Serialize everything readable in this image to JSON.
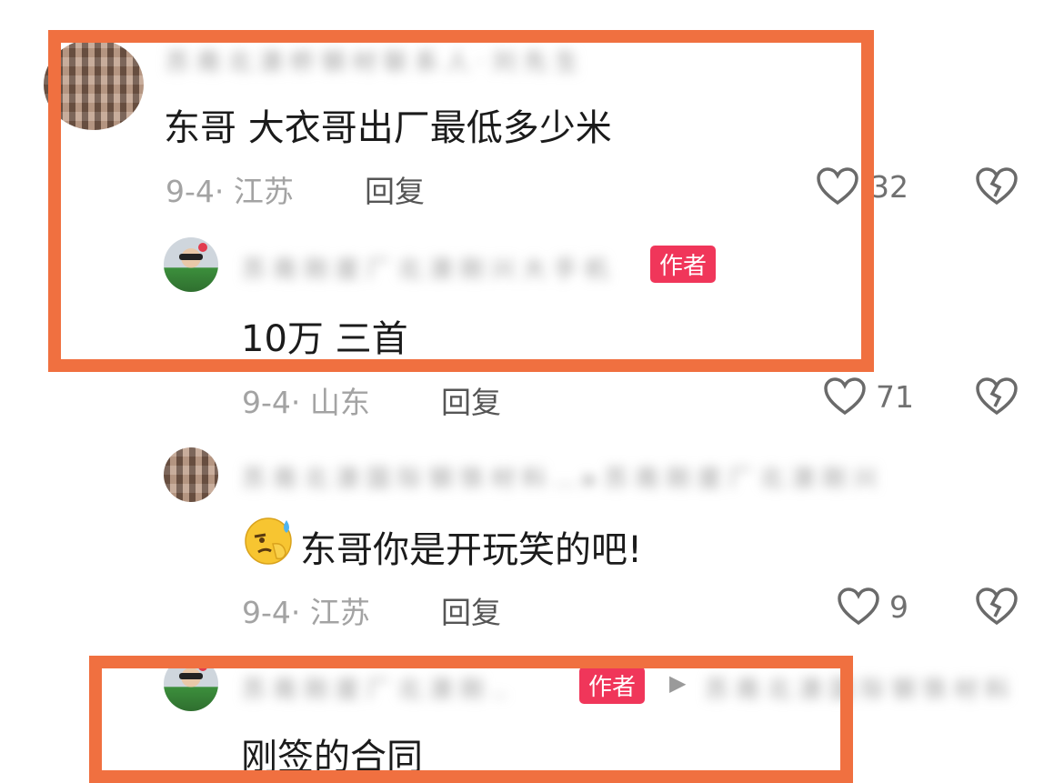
{
  "comments": [
    {
      "blurred_name": "苏 南 北 澳 桥 钢 材 联 系 人 · 刘 先 生",
      "text": "东哥  大衣哥出厂最低多少米",
      "date_loc": "9-4· 江苏",
      "reply_label": "回复",
      "likes": "32"
    },
    {
      "blurred_name": "苏 南 刚 度 厂  北 澳 刚 兴 大 手 机",
      "badge": "作者",
      "text": "10万 三首",
      "date_loc": "9-4· 山东",
      "reply_label": "回复",
      "likes": "71"
    },
    {
      "blurred_name": "苏 南 北 澳 国 际 钢 铁 材 料 …  ▸ 苏 南 刚 度 厂 北 澳 刚 兴",
      "text": "东哥你是开玩笑的吧!",
      "date_loc": "9-4· 江苏",
      "reply_label": "回复",
      "likes": "9"
    },
    {
      "blurred_name": "苏 南 刚 度 厂  北 澳 刚 ‥",
      "badge": "作者",
      "arrow": "▶",
      "blurred_target": "苏 南 北 澳 国 际 钢 铁 材 料",
      "text": "刚签的合同"
    }
  ],
  "colors": {
    "highlight": "#f07040",
    "badge": "#f0365a"
  },
  "icons": [
    "heart-icon",
    "dislike-heart-icon",
    "sweat-emoji-icon"
  ]
}
